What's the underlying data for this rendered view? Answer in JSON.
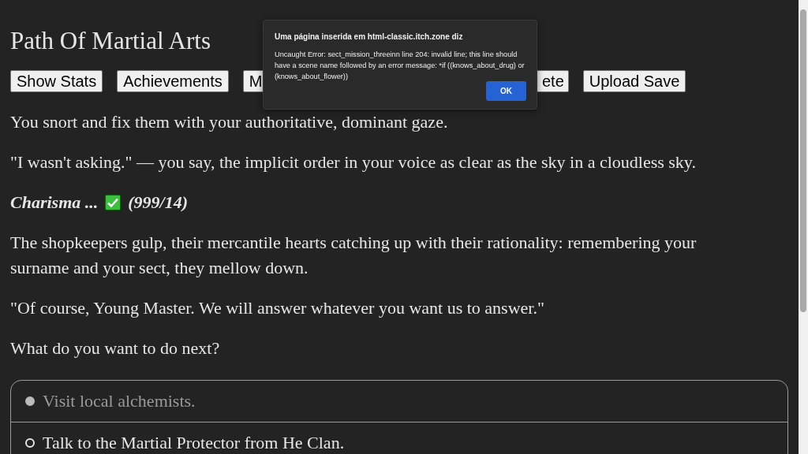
{
  "title": "Path Of Martial Arts",
  "buttons": [
    {
      "label": "Show Stats",
      "kind": "full"
    },
    {
      "label": "Achievements",
      "kind": "full"
    },
    {
      "label": "M",
      "kind": "cut_right"
    },
    {
      "label": "ete",
      "kind": "cut_left"
    },
    {
      "label": "Upload Save",
      "kind": "full"
    }
  ],
  "paragraphs": [
    {
      "kind": "text",
      "text": "You snort and fix them with your authoritative, dominant gaze."
    },
    {
      "kind": "text",
      "text": "\"I wasn't asking.\" — you say, the implicit order in your voice as clear as the sky in a cloudless sky."
    },
    {
      "kind": "stat_check",
      "label": "Charisma ...",
      "passed": true,
      "score": "(999/14)"
    },
    {
      "kind": "text",
      "text": "The shopkeepers gulp, their mercantile hearts catching up with their rationality: remembering your surname and your sect, they mellow down."
    },
    {
      "kind": "text",
      "text": "\"Of course, Young Master. We will answer whatever you want us to answer.\""
    },
    {
      "kind": "text",
      "text": "What do you want to do next?"
    }
  ],
  "choices": [
    {
      "text": "Visit local alchemists.",
      "disabled": true,
      "selected": false
    },
    {
      "text": "Talk to the Martial Protector from He Clan.",
      "disabled": false,
      "selected": false
    }
  ],
  "dialog": {
    "heading": "Uma página inserida em html-classic.itch.zone diz",
    "message": "Uncaught Error: sect_mission_threeinn line 204: invalid line; this line should have a scene name followed by an error message: *if ((knows_about_drug) or (knows_about_flower))",
    "button": "OK"
  }
}
